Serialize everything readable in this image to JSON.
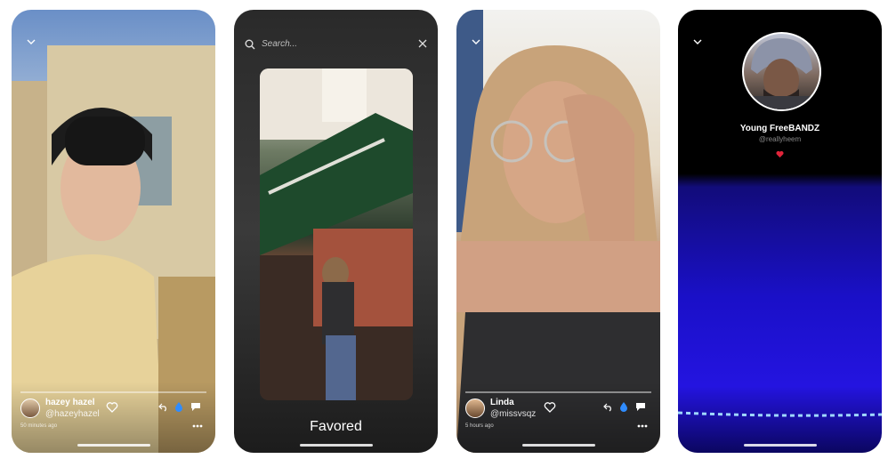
{
  "screens": [
    {
      "user": {
        "name": "hazey hazel",
        "handle": "@hazeyhazel"
      },
      "timestamp": "50 minutes ago",
      "icons": [
        "chevron-down-icon",
        "heart-icon",
        "reply-icon",
        "drop-icon",
        "comment-icon",
        "more-icon"
      ]
    },
    {
      "search": {
        "placeholder": "Search..."
      },
      "caption": "Favored",
      "icons": [
        "search-icon",
        "close-icon"
      ]
    },
    {
      "user": {
        "name": "Linda",
        "handle": "@missvsqz"
      },
      "timestamp": "5 hours ago",
      "icons": [
        "chevron-down-icon",
        "heart-icon",
        "reply-icon",
        "drop-icon",
        "comment-icon",
        "more-icon"
      ]
    },
    {
      "profile": {
        "name": "Young FreeBANDZ",
        "handle": "@reallyheem"
      },
      "icons": [
        "chevron-down-icon",
        "heart-icon"
      ]
    }
  ],
  "colors": {
    "accent_drop": "#2f8cff",
    "heart_red": "#e0243a",
    "profile_bg": "#1a10c8"
  }
}
